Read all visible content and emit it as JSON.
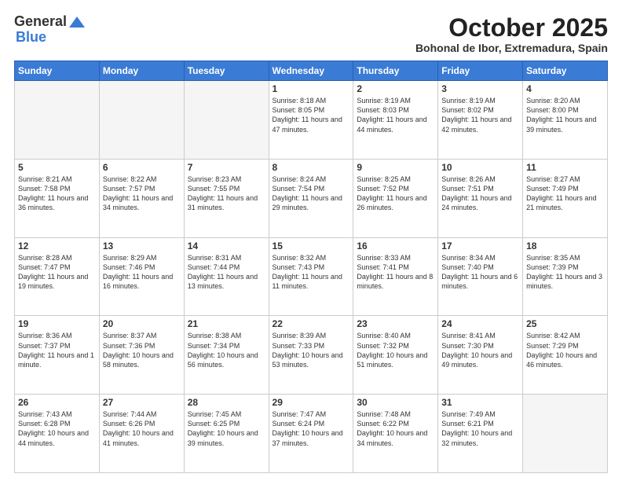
{
  "header": {
    "logo_general": "General",
    "logo_blue": "Blue",
    "month_title": "October 2025",
    "location": "Bohonal de Ibor, Extremadura, Spain"
  },
  "weekdays": [
    "Sunday",
    "Monday",
    "Tuesday",
    "Wednesday",
    "Thursday",
    "Friday",
    "Saturday"
  ],
  "weeks": [
    [
      {
        "day": "",
        "empty": true
      },
      {
        "day": "",
        "empty": true
      },
      {
        "day": "",
        "empty": true
      },
      {
        "day": "1",
        "sunrise": "8:18 AM",
        "sunset": "8:05 PM",
        "daylight": "11 hours and 47 minutes."
      },
      {
        "day": "2",
        "sunrise": "8:19 AM",
        "sunset": "8:03 PM",
        "daylight": "11 hours and 44 minutes."
      },
      {
        "day": "3",
        "sunrise": "8:19 AM",
        "sunset": "8:02 PM",
        "daylight": "11 hours and 42 minutes."
      },
      {
        "day": "4",
        "sunrise": "8:20 AM",
        "sunset": "8:00 PM",
        "daylight": "11 hours and 39 minutes."
      }
    ],
    [
      {
        "day": "5",
        "sunrise": "8:21 AM",
        "sunset": "7:58 PM",
        "daylight": "11 hours and 36 minutes."
      },
      {
        "day": "6",
        "sunrise": "8:22 AM",
        "sunset": "7:57 PM",
        "daylight": "11 hours and 34 minutes."
      },
      {
        "day": "7",
        "sunrise": "8:23 AM",
        "sunset": "7:55 PM",
        "daylight": "11 hours and 31 minutes."
      },
      {
        "day": "8",
        "sunrise": "8:24 AM",
        "sunset": "7:54 PM",
        "daylight": "11 hours and 29 minutes."
      },
      {
        "day": "9",
        "sunrise": "8:25 AM",
        "sunset": "7:52 PM",
        "daylight": "11 hours and 26 minutes."
      },
      {
        "day": "10",
        "sunrise": "8:26 AM",
        "sunset": "7:51 PM",
        "daylight": "11 hours and 24 minutes."
      },
      {
        "day": "11",
        "sunrise": "8:27 AM",
        "sunset": "7:49 PM",
        "daylight": "11 hours and 21 minutes."
      }
    ],
    [
      {
        "day": "12",
        "sunrise": "8:28 AM",
        "sunset": "7:47 PM",
        "daylight": "11 hours and 19 minutes."
      },
      {
        "day": "13",
        "sunrise": "8:29 AM",
        "sunset": "7:46 PM",
        "daylight": "11 hours and 16 minutes."
      },
      {
        "day": "14",
        "sunrise": "8:31 AM",
        "sunset": "7:44 PM",
        "daylight": "11 hours and 13 minutes."
      },
      {
        "day": "15",
        "sunrise": "8:32 AM",
        "sunset": "7:43 PM",
        "daylight": "11 hours and 11 minutes."
      },
      {
        "day": "16",
        "sunrise": "8:33 AM",
        "sunset": "7:41 PM",
        "daylight": "11 hours and 8 minutes."
      },
      {
        "day": "17",
        "sunrise": "8:34 AM",
        "sunset": "7:40 PM",
        "daylight": "11 hours and 6 minutes."
      },
      {
        "day": "18",
        "sunrise": "8:35 AM",
        "sunset": "7:39 PM",
        "daylight": "11 hours and 3 minutes."
      }
    ],
    [
      {
        "day": "19",
        "sunrise": "8:36 AM",
        "sunset": "7:37 PM",
        "daylight": "11 hours and 1 minute."
      },
      {
        "day": "20",
        "sunrise": "8:37 AM",
        "sunset": "7:36 PM",
        "daylight": "10 hours and 58 minutes."
      },
      {
        "day": "21",
        "sunrise": "8:38 AM",
        "sunset": "7:34 PM",
        "daylight": "10 hours and 56 minutes."
      },
      {
        "day": "22",
        "sunrise": "8:39 AM",
        "sunset": "7:33 PM",
        "daylight": "10 hours and 53 minutes."
      },
      {
        "day": "23",
        "sunrise": "8:40 AM",
        "sunset": "7:32 PM",
        "daylight": "10 hours and 51 minutes."
      },
      {
        "day": "24",
        "sunrise": "8:41 AM",
        "sunset": "7:30 PM",
        "daylight": "10 hours and 49 minutes."
      },
      {
        "day": "25",
        "sunrise": "8:42 AM",
        "sunset": "7:29 PM",
        "daylight": "10 hours and 46 minutes."
      }
    ],
    [
      {
        "day": "26",
        "sunrise": "7:43 AM",
        "sunset": "6:28 PM",
        "daylight": "10 hours and 44 minutes."
      },
      {
        "day": "27",
        "sunrise": "7:44 AM",
        "sunset": "6:26 PM",
        "daylight": "10 hours and 41 minutes."
      },
      {
        "day": "28",
        "sunrise": "7:45 AM",
        "sunset": "6:25 PM",
        "daylight": "10 hours and 39 minutes."
      },
      {
        "day": "29",
        "sunrise": "7:47 AM",
        "sunset": "6:24 PM",
        "daylight": "10 hours and 37 minutes."
      },
      {
        "day": "30",
        "sunrise": "7:48 AM",
        "sunset": "6:22 PM",
        "daylight": "10 hours and 34 minutes."
      },
      {
        "day": "31",
        "sunrise": "7:49 AM",
        "sunset": "6:21 PM",
        "daylight": "10 hours and 32 minutes."
      },
      {
        "day": "",
        "empty": true
      }
    ]
  ]
}
